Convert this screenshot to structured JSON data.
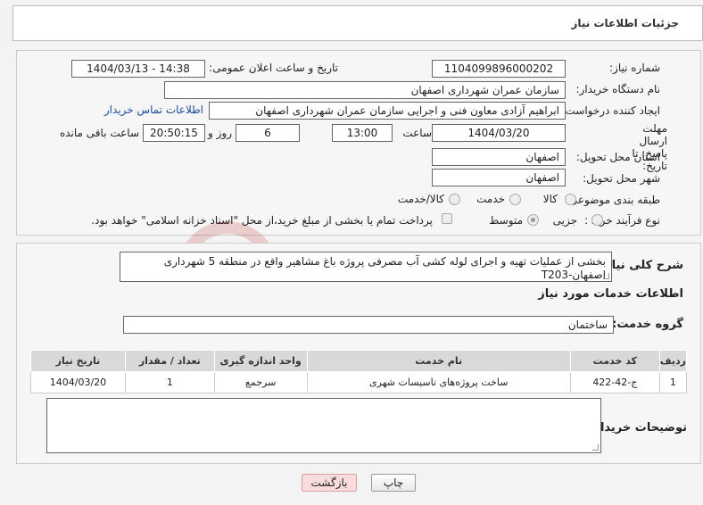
{
  "header": {
    "title": "جزئیات اطلاعات نیاز"
  },
  "form": {
    "need_number_label": "شماره نیاز:",
    "need_number": "1104099896000202",
    "announce_label": "تاریخ و ساعت اعلان عمومی:",
    "announce_value": "1404/03/13 - 14:38",
    "buyer_org_label": "نام دستگاه خریدار:",
    "buyer_org": "سازمان عمران شهرداری اصفهان",
    "creator_label": "ایجاد کننده درخواست:",
    "creator": "ابراهیم آزادی معاون فنی و اجرایی سازمان عمران شهرداری اصفهان",
    "contact_link": "اطلاعات تماس خریدار",
    "deadline_label": "مهلت ارسال پاسخ: تا تاریخ:",
    "deadline_date": "1404/03/20",
    "hour_label": "ساعت",
    "deadline_hour": "13:00",
    "days_value": "6",
    "days_label": "روز و",
    "remaining_value": "20:50:15",
    "remaining_label": "ساعت باقی مانده",
    "province_label": "استان محل تحویل:",
    "province": "اصفهان",
    "city_label": "شهر محل تحویل:",
    "city": "اصفهان",
    "category_label": "طبقه بندی موضوعی:",
    "category_options": [
      "کالا",
      "خدمت",
      "کالا/خدمت"
    ],
    "process_label": "نوع فرآیند خرید :",
    "process_options": [
      "جزیی",
      "متوسط"
    ],
    "payment_text": "پرداخت تمام یا بخشی از مبلغ خرید،از محل \"اسناد خزانه اسلامی\" خواهد بود."
  },
  "details": {
    "summary_label": "شرح کلی نیاز:",
    "summary": "بخشی از عملیات تهیه و اجرای لوله کشی آب مصرفی پروژه باغ مشاهیر واقع در منطقه 5 شهرداری اصفهان-T203",
    "services_heading": "اطلاعات خدمات مورد نیاز",
    "service_group_label": "گروه خدمت:",
    "service_group": "ساختمان",
    "table": {
      "headers": [
        "ردیف",
        "کد خدمت",
        "نام خدمت",
        "واحد اندازه گیری",
        "تعداد / مقدار",
        "تاریخ نیاز"
      ],
      "rows": [
        [
          "1",
          "ج-42-422",
          "ساخت پروژه‌های تاسیسات شهری",
          "سرجمع",
          "1",
          "1404/03/20"
        ]
      ]
    },
    "buyer_notes_label": "توضیحات خریدار:",
    "buyer_notes": ""
  },
  "buttons": {
    "print": "چاپ",
    "back": "بازگشت"
  },
  "watermark": {
    "text": "AriaTender.neT",
    "color": "#b00000"
  }
}
